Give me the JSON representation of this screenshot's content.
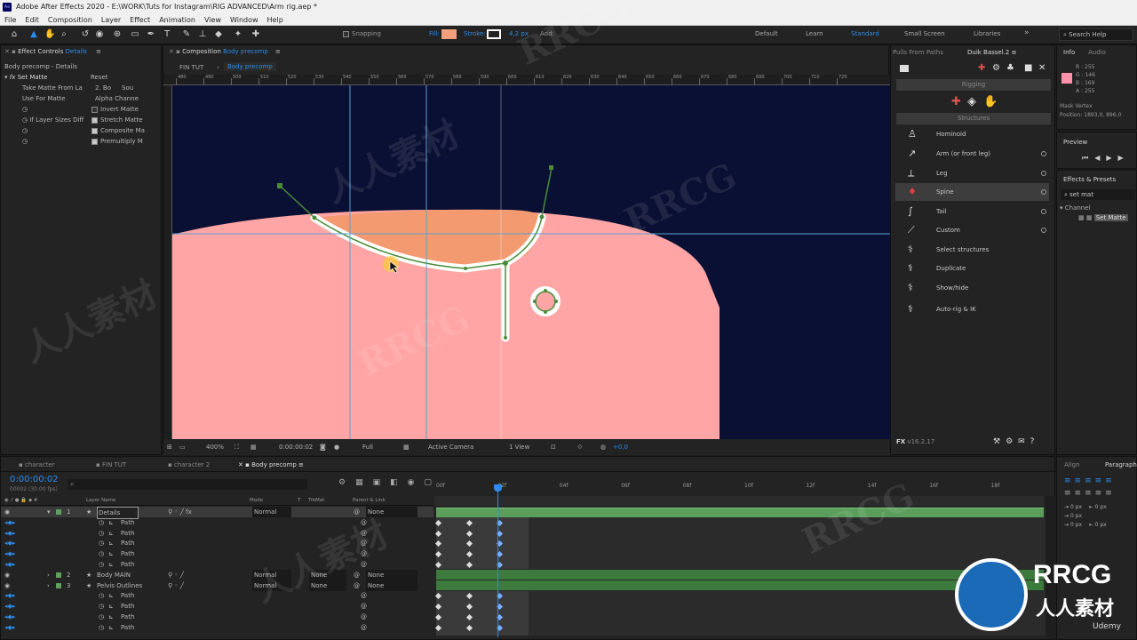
{
  "app": {
    "title": "Adobe After Effects 2020 - E:\\WORK\\Tuts for Instagram\\RIG ADVANCED\\Arm rig.aep *",
    "logo": "Ae"
  },
  "menu": [
    "File",
    "Edit",
    "Composition",
    "Layer",
    "Effect",
    "Animation",
    "View",
    "Window",
    "Help"
  ],
  "toolbar": {
    "snapping": "Snapping",
    "fill_label": "Fill:",
    "fill_color": "#f4a07a",
    "stroke_label": "Stroke:",
    "stroke_value": "4,2",
    "stroke_unit": "px",
    "add_label": "Add:",
    "workspaces": [
      "Default",
      "Learn",
      "Standard",
      "Small Screen",
      "Libraries"
    ],
    "active_workspace": "Standard",
    "search_help": "Search Help"
  },
  "effect_controls": {
    "tab": "Effect Controls",
    "tab_target": "Details",
    "breadcrumb": "Body precomp - Details",
    "effect_name": "Set Matte",
    "reset": "Reset",
    "props": [
      {
        "label": "Take Matte From La",
        "value": "2. Bo",
        "value2": "Sou"
      },
      {
        "label": "Use For Matte",
        "value": "Alpha Channe"
      },
      {
        "label": "",
        "checkbox": "Invert Matte",
        "checked": false
      },
      {
        "label": "If Layer Sizes Diff",
        "checkbox": "Stretch Matte",
        "checked": true
      },
      {
        "label": "",
        "checkbox": "Composite Ma",
        "checked": true
      },
      {
        "label": "",
        "checkbox": "Premultiply M",
        "checked": true
      }
    ]
  },
  "composition": {
    "tab_prefix": "Composition",
    "tab_name": "Body precomp",
    "breadcrumb": [
      "FIN TUT",
      "Body precomp"
    ],
    "ruler_labels": [
      "480",
      "490",
      "500",
      "510",
      "520",
      "530",
      "540",
      "550",
      "560",
      "570",
      "580",
      "590",
      "600",
      "610",
      "620",
      "630",
      "640",
      "650",
      "660",
      "670",
      "680",
      "690",
      "700",
      "710",
      "720"
    ],
    "zoom": "400%",
    "timecode": "0:00:00:02",
    "resolution": "Full",
    "camera": "Active Camera",
    "views": "1 View",
    "exposure": "+0,0",
    "colors": {
      "bg": "#0a1033",
      "body": "#ffa5a5",
      "fill_shape": "#f49a70",
      "path": "#4a8c3a"
    }
  },
  "duik": {
    "tab_left": "Pulls From Paths",
    "tab": "Duik Bassel.2",
    "rigging": "Rigging",
    "structures": "Structures",
    "items": [
      {
        "label": "Hominoid",
        "icon": "hominoid-icon",
        "dot": false
      },
      {
        "label": "Arm (or front leg)",
        "icon": "arm-icon",
        "dot": true
      },
      {
        "label": "Leg",
        "icon": "leg-icon",
        "dot": true
      },
      {
        "label": "Spine",
        "icon": "spine-icon",
        "dot": true,
        "active": true
      },
      {
        "label": "Tail",
        "icon": "tail-icon",
        "dot": true
      },
      {
        "label": "Custom",
        "icon": "custom-icon",
        "dot": true
      },
      {
        "label": "Select structures",
        "icon": "select-icon",
        "dot": false
      },
      {
        "label": "Duplicate",
        "icon": "duplicate-icon",
        "dot": false
      },
      {
        "label": "Show/hide",
        "icon": "eye-icon",
        "dot": false
      },
      {
        "label": "Auto-rig & IK",
        "icon": "autorig-icon",
        "dot": false
      }
    ],
    "version": "v16.2.17"
  },
  "info": {
    "tabs": [
      "Info",
      "Audio"
    ],
    "r": "R : 255",
    "g": "G : 146",
    "b": "B : 169",
    "a": "A : 255",
    "swatch": "#ff92a9",
    "mask_vertex": "Mask Vertex",
    "position": "Position: 1893,0, 896,0"
  },
  "preview": {
    "label": "Preview"
  },
  "effects_presets": {
    "label": "Effects & Presets",
    "search": "set mat",
    "category": "Channel",
    "result": "Set Matte"
  },
  "align": {
    "tabs": [
      "Align",
      "Paragraph"
    ],
    "vals": [
      "0 px",
      "0 px",
      "0 px",
      "0 px",
      "0 px"
    ]
  },
  "timeline": {
    "tabs": [
      "character",
      "FIN TUT",
      "character 2",
      "Body precomp"
    ],
    "active_tab": "Body precomp",
    "timecode": "0:00:00:02",
    "frame_info": "00002 (30.00 fps)",
    "columns": [
      "Layer Name",
      "Mode",
      "T",
      "TrkMat",
      "Parent & Link"
    ],
    "time_labels": [
      "00f",
      "02f",
      "04f",
      "06f",
      "08f",
      "10f",
      "12f",
      "14f",
      "16f",
      "18f"
    ],
    "layers": [
      {
        "num": "1",
        "name": "Details",
        "mode": "Normal",
        "trkmat": "",
        "parent": "None",
        "selected": true
      },
      {
        "sub": "Path"
      },
      {
        "sub": "Path"
      },
      {
        "sub": "Path"
      },
      {
        "sub": "Path"
      },
      {
        "sub": "Path"
      },
      {
        "num": "2",
        "name": "Body MAIN",
        "mode": "Normal",
        "trkmat": "None",
        "parent": "None"
      },
      {
        "num": "3",
        "name": "Pelvis Outlines",
        "mode": "Normal",
        "trkmat": "None",
        "parent": "None"
      },
      {
        "sub": "Path"
      },
      {
        "sub": "Path"
      },
      {
        "sub": "Path"
      },
      {
        "sub": "Path"
      }
    ]
  },
  "watermarks": {
    "brand": "RRCG",
    "cn": "人人素材",
    "udemy": "Udemy"
  }
}
